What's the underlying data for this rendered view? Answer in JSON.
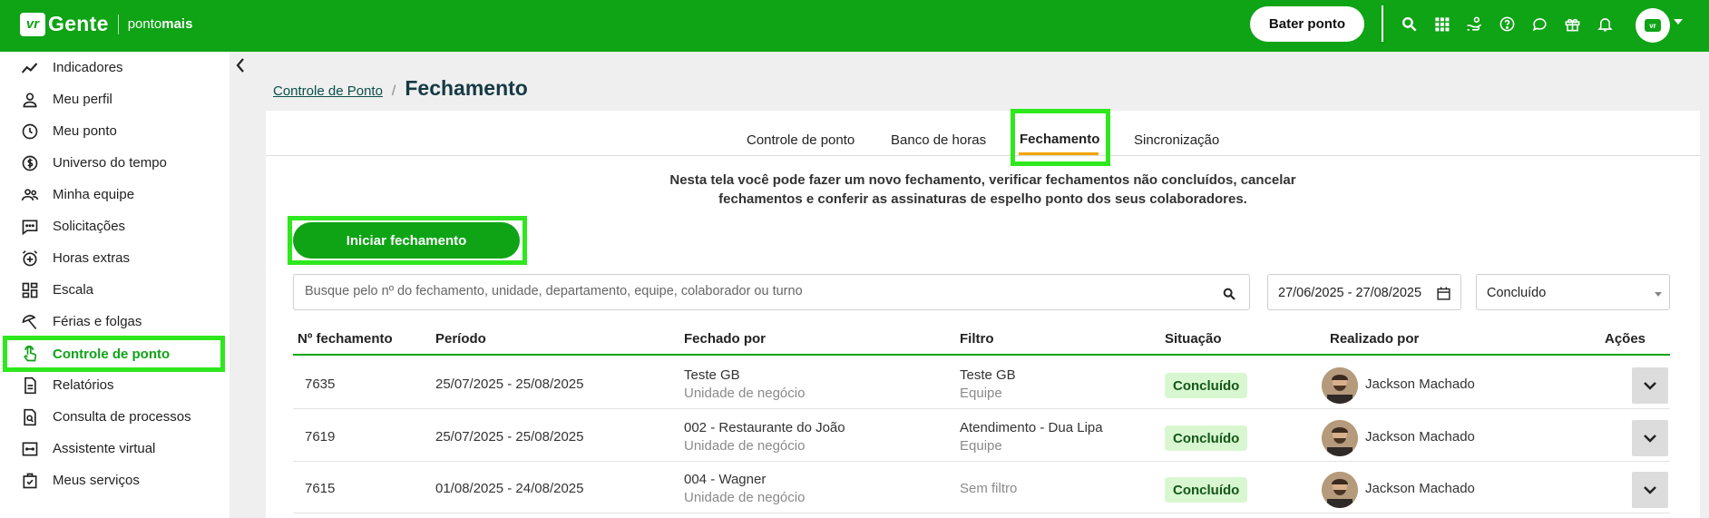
{
  "brand": {
    "logo": "vr",
    "name": "Gente",
    "sub_a": "ponto",
    "sub_b": "mais"
  },
  "topbar": {
    "bater_ponto": "Bater ponto",
    "icons": [
      "search-icon",
      "apps-grid-icon",
      "hand-coins-icon",
      "help-icon",
      "chat-icon",
      "gift-icon",
      "bell-icon"
    ],
    "avatar_logo": "vr"
  },
  "sidebar": {
    "items": [
      {
        "label": "Indicadores",
        "icon": "chart-line-icon"
      },
      {
        "label": "Meu perfil",
        "icon": "user-icon"
      },
      {
        "label": "Meu ponto",
        "icon": "clock-icon"
      },
      {
        "label": "Universo do tempo",
        "icon": "dollar-circle-icon"
      },
      {
        "label": "Minha equipe",
        "icon": "team-icon"
      },
      {
        "label": "Solicitações",
        "icon": "message-square-icon"
      },
      {
        "label": "Horas extras",
        "icon": "alarm-plus-icon"
      },
      {
        "label": "Escala",
        "icon": "dashboard-grid-icon"
      },
      {
        "label": "Férias e folgas",
        "icon": "beach-umbrella-icon"
      },
      {
        "label": "Controle de ponto",
        "icon": "touch-hand-icon",
        "active": true
      },
      {
        "label": "Relatórios",
        "icon": "document-icon"
      },
      {
        "label": "Consulta de processos",
        "icon": "document-search-icon"
      },
      {
        "label": "Assistente virtual",
        "icon": "assistant-icon"
      },
      {
        "label": "Meus serviços",
        "icon": "briefcase-check-icon"
      }
    ]
  },
  "breadcrumb": {
    "parent": "Controle de Ponto",
    "separator": "/",
    "current": "Fechamento"
  },
  "tabs": [
    {
      "label": "Controle de ponto"
    },
    {
      "label": "Banco de horas"
    },
    {
      "label": "Fechamento",
      "active": true
    },
    {
      "label": "Sincronização"
    }
  ],
  "info": {
    "line1": "Nesta tela você pode fazer um novo fechamento, verificar fechamentos não concluídos, cancelar",
    "line2": "fechamentos e conferir as assinaturas de espelho ponto dos seus colaboradores."
  },
  "start_button": "Iniciar fechamento",
  "filters": {
    "search_placeholder": "Busque pelo nº do fechamento, unidade, departamento, equipe, colaborador ou turno",
    "date_range": "27/06/2025 - 27/08/2025",
    "status": "Concluído"
  },
  "table": {
    "columns": [
      "Nº fechamento",
      "Período",
      "Fechado por",
      "Filtro",
      "Situação",
      "Realizado por",
      "Ações"
    ],
    "rows": [
      {
        "number": "7635",
        "period": "25/07/2025 - 25/08/2025",
        "closed_by": "Teste GB",
        "closed_by_type": "Unidade de negócio",
        "filter": "Teste GB",
        "filter_type": "Equipe",
        "status": "Concluído",
        "done_by": "Jackson Machado"
      },
      {
        "number": "7619",
        "period": "25/07/2025 - 25/08/2025",
        "closed_by": "002 - Restaurante do João",
        "closed_by_type": "Unidade de negócio",
        "filter": "Atendimento - Dua Lipa",
        "filter_type": "Equipe",
        "status": "Concluído",
        "done_by": "Jackson Machado"
      },
      {
        "number": "7615",
        "period": "01/08/2025 - 24/08/2025",
        "closed_by": "004 - Wagner",
        "closed_by_type": "Unidade de negócio",
        "filter": "",
        "filter_type": "Sem filtro",
        "status": "Concluído",
        "done_by": "Jackson Machado"
      }
    ]
  },
  "colors": {
    "brand_green": "#0fa316",
    "highlight": "#2ee81d",
    "tab_underline": "#f4a300",
    "badge_bg": "#d8f7d0"
  }
}
